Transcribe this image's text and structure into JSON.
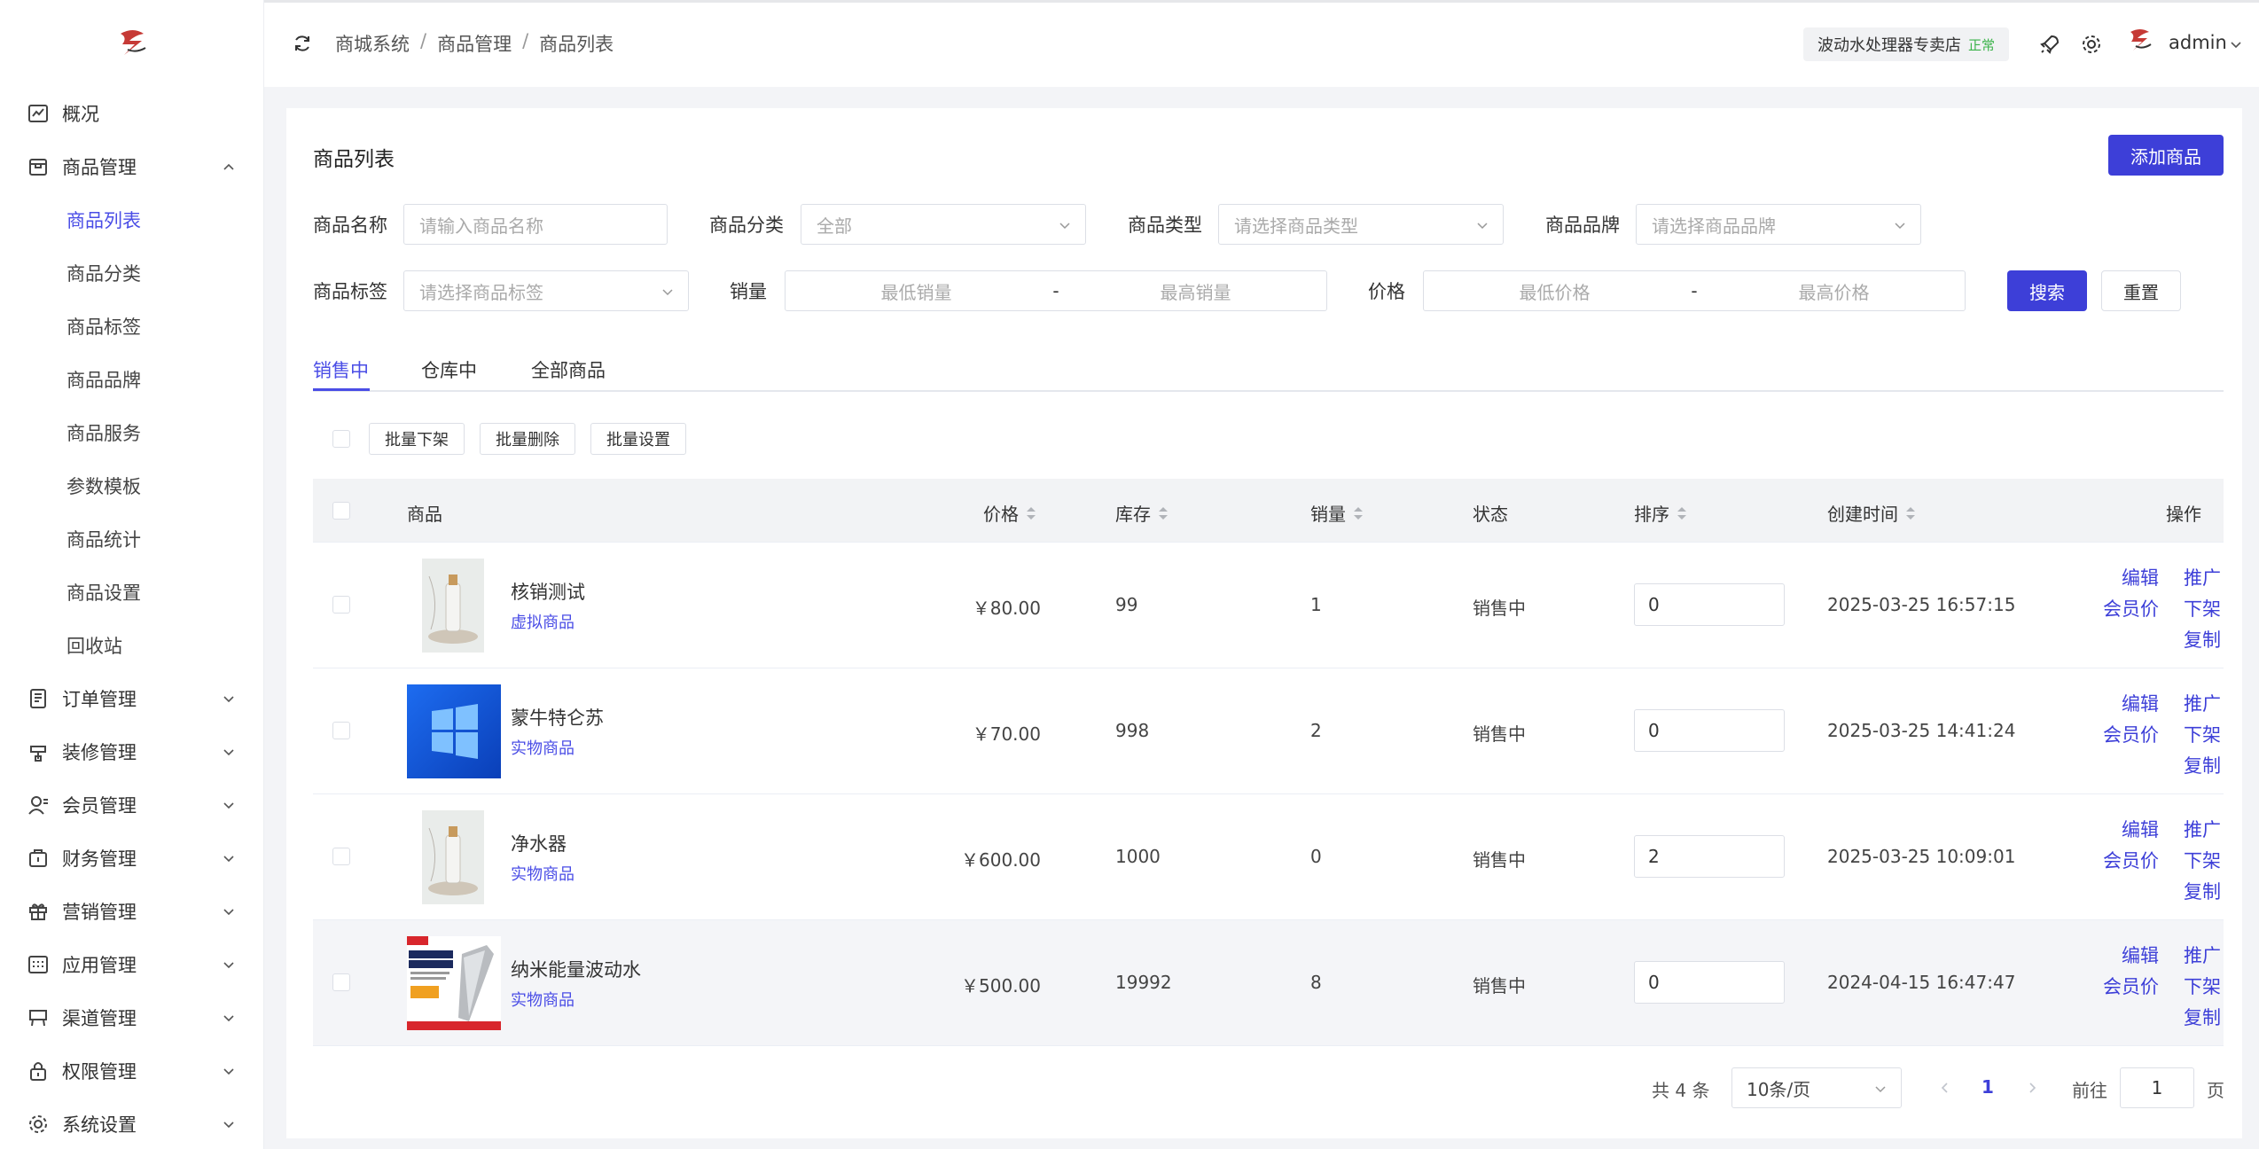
{
  "sidebar": {
    "items": [
      {
        "label": "概况"
      },
      {
        "label": "商品管理",
        "sub": [
          "商品列表",
          "商品分类",
          "商品标签",
          "商品品牌",
          "商品服务",
          "参数模板",
          "商品统计",
          "商品设置",
          "回收站"
        ]
      },
      {
        "label": "订单管理"
      },
      {
        "label": "装修管理"
      },
      {
        "label": "会员管理"
      },
      {
        "label": "财务管理"
      },
      {
        "label": "营销管理"
      },
      {
        "label": "应用管理"
      },
      {
        "label": "渠道管理"
      },
      {
        "label": "权限管理"
      },
      {
        "label": "系统设置"
      }
    ]
  },
  "header": {
    "breadcrumb": [
      "商城系统",
      "商品管理",
      "商品列表"
    ],
    "shop_name": "波动水处理器专卖店",
    "shop_status": "正常",
    "username": "admin"
  },
  "main": {
    "title": "商品列表",
    "add_button": "添加商品",
    "filters": {
      "name_label": "商品名称",
      "name_placeholder": "请输入商品名称",
      "category_label": "商品分类",
      "category_value": "全部",
      "type_label": "商品类型",
      "type_placeholder": "请选择商品类型",
      "brand_label": "商品品牌",
      "brand_placeholder": "请选择商品品牌",
      "tag_label": "商品标签",
      "tag_placeholder": "请选择商品标签",
      "sales_label": "销量",
      "sales_min": "最低销量",
      "sales_max": "最高销量",
      "price_label": "价格",
      "price_min": "最低价格",
      "price_max": "最高价格",
      "search": "搜索",
      "reset": "重置",
      "dash": "-"
    },
    "tabs": [
      "销售中",
      "仓库中",
      "全部商品"
    ],
    "batch": [
      "批量下架",
      "批量删除",
      "批量设置"
    ],
    "columns": {
      "product": "商品",
      "price": "价格",
      "stock": "库存",
      "sales": "销量",
      "status": "状态",
      "sort": "排序",
      "created": "创建时间",
      "actions": "操作"
    },
    "rows": [
      {
        "name": "核销测试",
        "type": "虚拟商品",
        "price": "￥80.00",
        "stock": "99",
        "sales": "1",
        "status": "销售中",
        "sort": "0",
        "created": "2025-03-25 16:57:15"
      },
      {
        "name": "蒙牛特仑苏",
        "type": "实物商品",
        "price": "￥70.00",
        "stock": "998",
        "sales": "2",
        "status": "销售中",
        "sort": "0",
        "created": "2025-03-25 14:41:24"
      },
      {
        "name": "净水器",
        "type": "实物商品",
        "price": "￥600.00",
        "stock": "1000",
        "sales": "0",
        "status": "销售中",
        "sort": "2",
        "created": "2025-03-25 10:09:01"
      },
      {
        "name": "纳米能量波动水",
        "type": "实物商品",
        "price": "￥500.00",
        "stock": "19992",
        "sales": "8",
        "status": "销售中",
        "sort": "0",
        "created": "2024-04-15 16:47:47"
      }
    ],
    "actions": {
      "edit": "编辑",
      "promote": "推广",
      "member_price": "会员价",
      "off_shelf": "下架",
      "copy": "复制"
    },
    "pagination": {
      "total": "共 4 条",
      "page_size": "10条/页",
      "current": "1",
      "goto_label": "前往",
      "goto_value": "1",
      "page_unit": "页"
    }
  },
  "colors": {
    "accent": "#3d3fd8",
    "link": "#4a4de6",
    "success": "#3cb34a"
  }
}
